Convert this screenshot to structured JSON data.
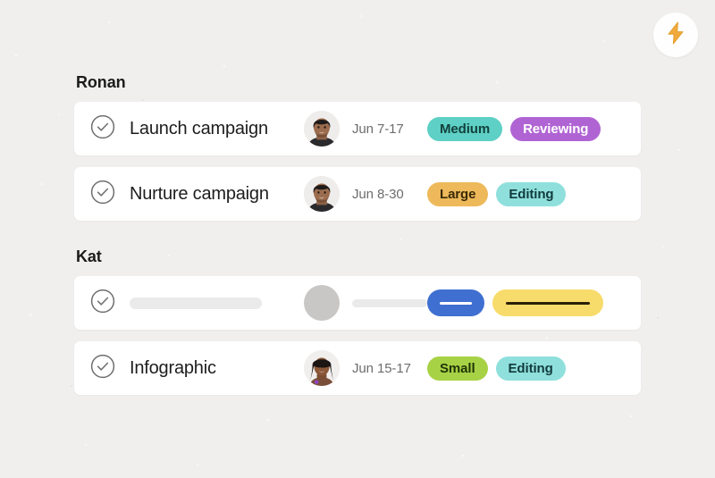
{
  "background_color": "#f0efee",
  "header": {
    "bolt_button": {
      "icon": "lightning-bolt-icon",
      "color": "#f0ab3c",
      "background": "#fefefe"
    }
  },
  "groups": [
    {
      "name": "Ronan",
      "tasks": [
        {
          "status_icon": "check-circle-icon",
          "title": "Launch campaign",
          "avatar": "avatar-ronan",
          "date": "Jun 7-17",
          "badges": [
            {
              "label": "Medium",
              "background": "#5ed0c5",
              "color": "#12403c"
            },
            {
              "label": "Reviewing",
              "background": "#b064d4",
              "color": "#ffffff"
            }
          ]
        },
        {
          "status_icon": "check-circle-icon",
          "title": "Nurture campaign",
          "avatar": "avatar-ronan",
          "date": "Jun 8-30",
          "badges": [
            {
              "label": "Large",
              "background": "#eeb košicel",
              "color": "#3a2a07"
            },
            {
              "label": "Editing",
              "background": "#8fe0dc",
              "color": "#123b3c"
            }
          ]
        }
      ]
    },
    {
      "name": "Kat",
      "tasks": [
        {
          "skeleton": true,
          "status_icon": "check-circle-icon",
          "badges": [
            {
              "background": "#3f6fd0",
              "line_color": "#ffffff",
              "width": 64,
              "line_width": 36
            },
            {
              "background": "#f7dc6b",
              "line_color": "#2a2008",
              "width": 124,
              "line_width": 94
            }
          ]
        },
        {
          "status_icon": "check-circle-icon",
          "title": "Infographic",
          "avatar": "avatar-kat",
          "date": "Jun 15-17",
          "badges": [
            {
              "label": "Small",
              "background": "#a8d246",
              "color": "#1f3406"
            },
            {
              "label": "Editing",
              "background": "#8fe0dc",
              "color": "#123b3c"
            }
          ]
        }
      ]
    }
  ]
}
